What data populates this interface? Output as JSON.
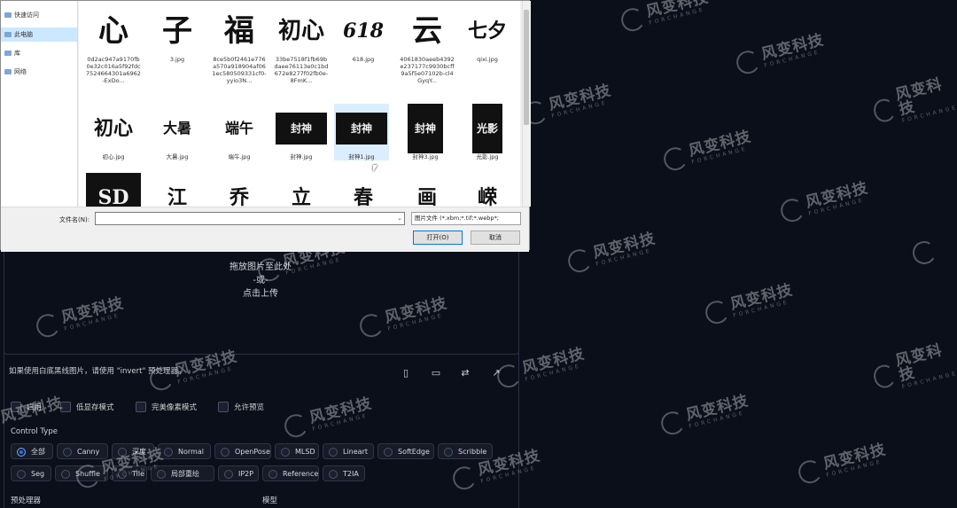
{
  "dialog": {
    "nav_items": [
      {
        "label": "快速访问",
        "icon": "star-icon"
      },
      {
        "label": "此电脑",
        "icon": "computer-icon"
      },
      {
        "label": "库",
        "icon": "library-icon"
      },
      {
        "label": "网络",
        "icon": "network-icon"
      }
    ],
    "files_row1": [
      {
        "name": "0d2ac947a9170fb0e32c016a5f92fdc7524664301a6962-ExDo...",
        "glyph": "心"
      },
      {
        "name": "3.jpg",
        "glyph": "子"
      },
      {
        "name": "8ce5b0f2461e776a570a918904af061ec580509331cf0-yyio3N...",
        "glyph": "福"
      },
      {
        "name": "33be7518f1fb69bdaee76113e0c1bd672e8277f02fb0e-8FmK...",
        "glyph": "初心"
      },
      {
        "name": "618.jpg",
        "glyph": "618"
      },
      {
        "name": "4061830aeeb4392e237177c9930bcff9a5f5e07102b-cl4GyqY...",
        "glyph": "云"
      },
      {
        "name": "qixi.jpg",
        "glyph": "七夕"
      }
    ],
    "files_row2": [
      {
        "name": "初心.jpg",
        "glyph": "初心",
        "dark": false
      },
      {
        "name": "大暑.jpg",
        "glyph": "大暑",
        "dark": false
      },
      {
        "name": "端午.jpg",
        "glyph": "端午",
        "dark": false
      },
      {
        "name": "封神.jpg",
        "glyph": "封神",
        "dark": true
      },
      {
        "name": "封神1.jpg",
        "glyph": "封神",
        "dark": true
      },
      {
        "name": "封神3.jpg",
        "glyph": "封神",
        "dark": true
      },
      {
        "name": "光影.jpg",
        "glyph": "光影",
        "dark": true
      }
    ],
    "files_row3": [
      {
        "glyph": "SD",
        "dark": true
      },
      {
        "glyph": "江",
        "dark": false
      },
      {
        "glyph": "乔",
        "dark": false
      },
      {
        "glyph": "立",
        "dark": false
      },
      {
        "glyph": "春",
        "dark": false
      },
      {
        "glyph": "画",
        "dark": false
      },
      {
        "glyph": "嵘",
        "dark": false
      }
    ],
    "filename_label": "文件名(N):",
    "filename_value": "",
    "filetype": "图片文件 (*.xbm;*.tif;*.webp*;",
    "open_button": "打开(O)",
    "cancel_button": "取消"
  },
  "panel": {
    "drop_line1": "拖放图片至此处",
    "drop_line2": "-或-",
    "drop_line3": "点击上传",
    "hint": "如果使用白底黑线图片，请使用 \"invert\" 预处理器。",
    "checkboxes": [
      "启用",
      "低显存模式",
      "完美像素模式",
      "允许预览"
    ],
    "control_type_label": "Control Type",
    "control_types_row1": [
      "全部",
      "Canny",
      "深度",
      "Normal",
      "OpenPose",
      "MLSD",
      "Lineart",
      "SoftEdge",
      "Scribble"
    ],
    "control_types_row2": [
      "Seg",
      "Shuffle",
      "Tile",
      "局部重绘",
      "IP2P",
      "Reference",
      "T2IA"
    ],
    "selected_control_type": "全部",
    "preprocessor_label": "预处理器",
    "model_label": "模型"
  },
  "watermark": {
    "main": "风变科技",
    "sub": "FORCHANGE"
  }
}
